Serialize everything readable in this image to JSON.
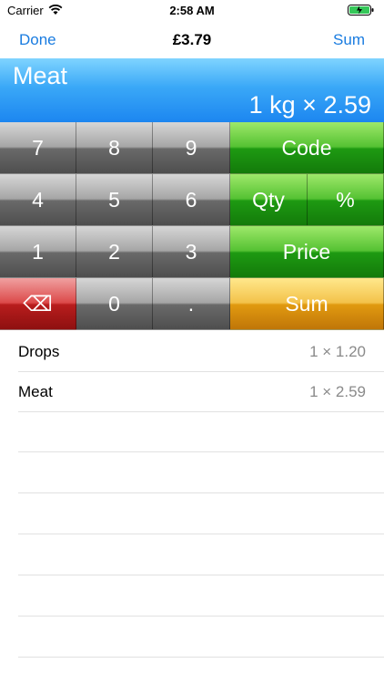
{
  "status_bar": {
    "carrier": "Carrier",
    "time": "2:58 AM"
  },
  "nav": {
    "left_label": "Done",
    "title": "£3.79",
    "right_label": "Sum"
  },
  "display": {
    "item_name": "Meat",
    "expression": "1 kg × 2.59"
  },
  "keypad": {
    "digits": [
      "7",
      "8",
      "9",
      "4",
      "5",
      "6",
      "1",
      "2",
      "3",
      "0",
      "."
    ],
    "backspace": "⌫",
    "code": "Code",
    "qty": "Qty",
    "percent": "%",
    "price": "Price",
    "sum": "Sum"
  },
  "items": [
    {
      "name": "Drops",
      "detail": "1 × 1.20"
    },
    {
      "name": "Meat",
      "detail": "1 × 2.59"
    }
  ],
  "colors": {
    "accent": "#1a7ce0",
    "display_blue": "#1c86f0",
    "key_green": "#1e9a12",
    "key_orange": "#e19a10",
    "key_red": "#b81d1d"
  }
}
